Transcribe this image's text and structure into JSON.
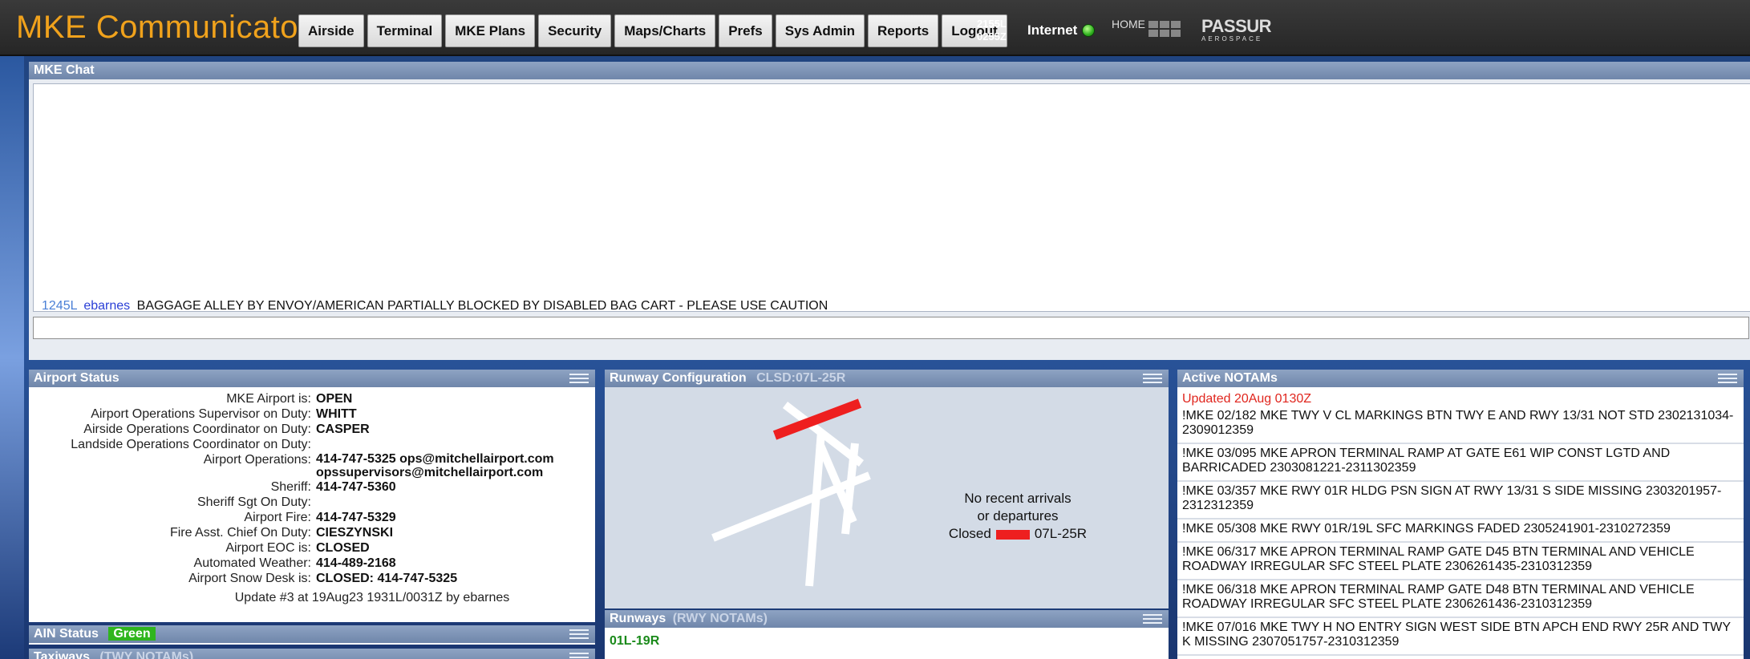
{
  "app": {
    "title": "MKE Communicator"
  },
  "nav": [
    "Airside",
    "Terminal",
    "MKE Plans",
    "Security",
    "Maps/Charts",
    "Prefs",
    "Sys Admin",
    "Reports",
    "Logout"
  ],
  "clock": {
    "local": "2155L",
    "zulu": "0255Z"
  },
  "internet": {
    "label": "Internet",
    "status_color": "#2fb01e"
  },
  "home_label": "HOME",
  "brand": {
    "name": "PASSUR",
    "sub": "AEROSPACE"
  },
  "chat": {
    "title": "MKE Chat",
    "messages": [
      {
        "time": "1245L",
        "user": "ebarnes",
        "text": "BAGGAGE ALLEY BY ENVOY/AMERICAN PARTIALLY BLOCKED BY DISABLED BAG CART - PLEASE USE CAUTION"
      }
    ],
    "input_value": ""
  },
  "airport_status": {
    "title": "Airport Status",
    "rows": [
      {
        "label": "MKE Airport is:",
        "value": "OPEN"
      },
      {
        "label": "Airport Operations Supervisor on Duty:",
        "value": "WHITT"
      },
      {
        "label": "Airside Operations Coordinator on Duty:",
        "value": "CASPER"
      },
      {
        "label": "Landside Operations Coordinator on Duty:",
        "value": ""
      },
      {
        "label": "Airport Operations:",
        "value": "414-747-5325 ops@mitchellairport.com\nopssupervisors@mitchellairport.com"
      },
      {
        "label": "Sheriff:",
        "value": "414-747-5360"
      },
      {
        "label": "Sheriff Sgt On Duty:",
        "value": ""
      },
      {
        "label": "Airport Fire:",
        "value": "414-747-5329"
      },
      {
        "label": "Fire Asst. Chief On Duty:",
        "value": "CIESZYNSKI"
      },
      {
        "label": "Airport EOC is:",
        "value": "CLOSED"
      },
      {
        "label": "Automated Weather:",
        "value": "414-489-2168"
      },
      {
        "label": "Airport Snow Desk is:",
        "value": "CLOSED: 414-747-5325"
      }
    ],
    "update": "Update #3 at 19Aug23 1931L/0031Z by ebarnes"
  },
  "ain_status": {
    "title": "AIN Status",
    "value": "Green",
    "color": "#2fb51d"
  },
  "taxiways": {
    "title": "Taxiways",
    "sub": "(TWY NOTAMs)"
  },
  "runway_config": {
    "title": "Runway Configuration",
    "closed_label": "CLSD:07L-25R",
    "no_recent_1": "No recent arrivals",
    "no_recent_2": "or departures",
    "closed_prefix": "Closed",
    "closed_runway": "07L-25R",
    "closed_color": "#ee1f1f"
  },
  "runways": {
    "title": "Runways",
    "sub": "(RWY NOTAMs)",
    "first": "01L-19R"
  },
  "notams": {
    "title": "Active NOTAMs",
    "updated": "Updated 20Aug 0130Z",
    "items": [
      "!MKE 02/182 MKE TWY V CL MARKINGS BTN TWY E AND RWY 13/31 NOT STD 2302131034-2309012359",
      "!MKE 03/095 MKE APRON TERMINAL RAMP AT GATE E61 WIP CONST LGTD AND BARRICADED 2303081221-2311302359",
      "!MKE 03/357 MKE RWY 01R HLDG PSN SIGN AT RWY 13/31 S SIDE MISSING 2303201957-2312312359",
      "!MKE 05/308 MKE RWY 01R/19L SFC MARKINGS FADED 2305241901-2310272359",
      "!MKE 06/317 MKE APRON TERMINAL RAMP GATE D45 BTN TERMINAL AND VEHICLE ROADWAY IRREGULAR SFC STEEL PLATE 2306261435-2310312359",
      "!MKE 06/318 MKE APRON TERMINAL RAMP GATE D48 BTN TERMINAL AND VEHICLE ROADWAY IRREGULAR SFC STEEL PLATE 2306261436-2310312359",
      "!MKE 07/016 MKE TWY H NO ENTRY SIGN WEST SIDE BTN APCH END RWY 25R AND TWY K MISSING 2307051757-2310312359"
    ]
  }
}
